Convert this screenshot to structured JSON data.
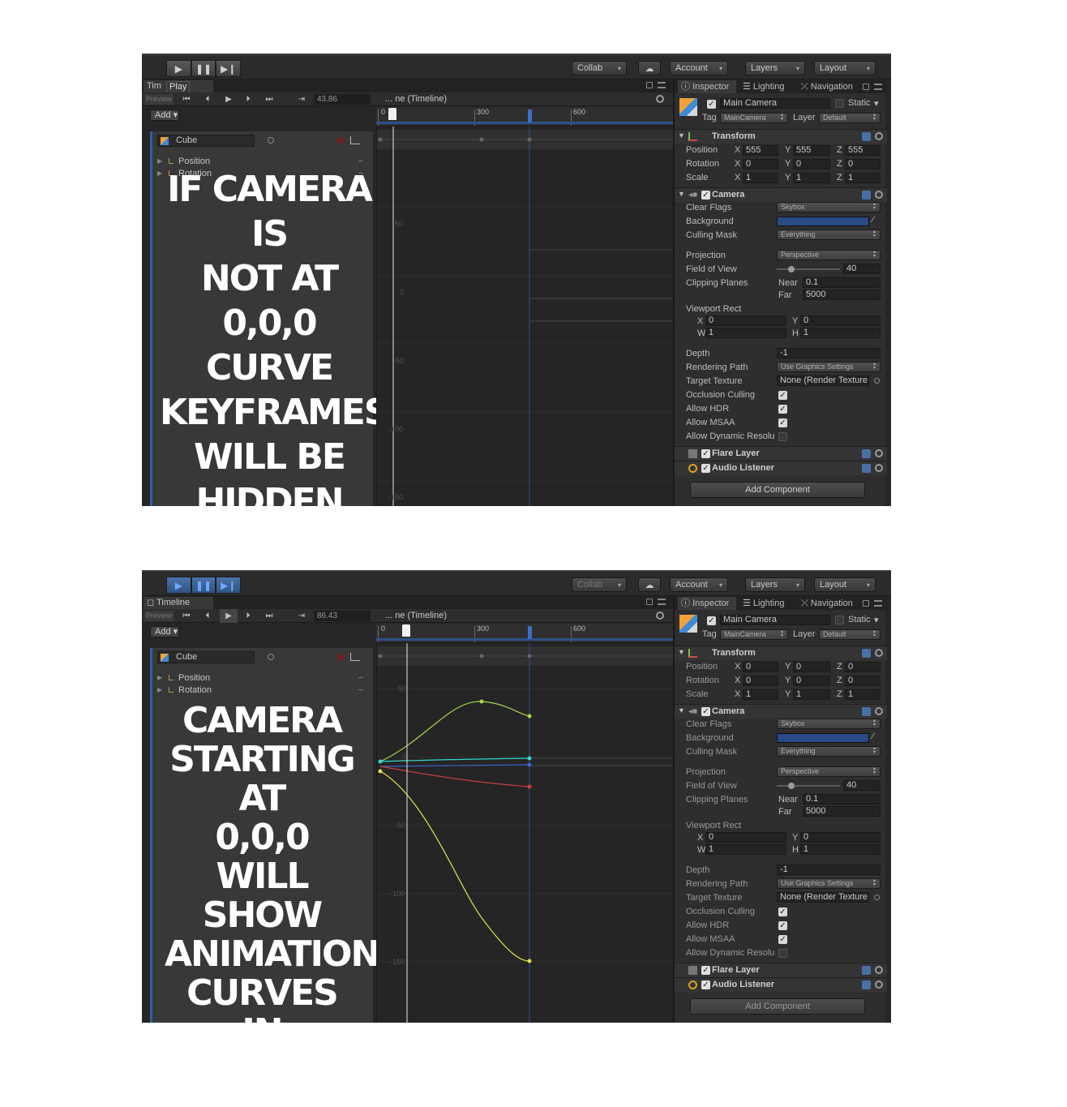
{
  "toolbar": {
    "collab": "Collab",
    "account": "Account",
    "layers": "Layers",
    "layout": "Layout"
  },
  "timeline": {
    "tab_label_1": "Tim",
    "tab_label_2": "Timeline",
    "tooltip": "Play",
    "preview": "Preview",
    "frame_1": "43.86",
    "frame_2": "86.43",
    "binding": "... ne (Timeline)",
    "add_button": "Add",
    "track_object": "Cube",
    "properties": [
      "Position",
      "Rotation"
    ],
    "ruler_labels": [
      "0",
      "300",
      "600"
    ],
    "value_labels": [
      "50",
      "0",
      "-50",
      "-100",
      "-150"
    ]
  },
  "captions": {
    "top": "IF CAMERA IS\nNOT AT 0,0,0\nCURVE\nKEYFRAMES\nWILL BE HIDDEN\nAFTER PRESSING\nPLAY",
    "bottom": "CAMERA\nSTARTING AT\n0,0,0 WILL\nSHOW\nANIMATION\nCURVES IN\nTIMELINE"
  },
  "inspector": {
    "tabs": [
      "Inspector",
      "Lighting",
      "Navigation"
    ],
    "object_name": "Main Camera",
    "static": "Static",
    "tag_label": "Tag",
    "tag_value": "MainCamera",
    "layer_label": "Layer",
    "layer_value": "Default",
    "transform": {
      "title": "Transform",
      "labels": [
        "Position",
        "Rotation",
        "Scale"
      ],
      "axes": [
        "X",
        "Y",
        "Z"
      ],
      "values_1": [
        [
          "555",
          "555",
          "555"
        ],
        [
          "0",
          "0",
          "0"
        ],
        [
          "1",
          "1",
          "1"
        ]
      ],
      "values_2": [
        [
          "0",
          "0",
          "0"
        ],
        [
          "0",
          "0",
          "0"
        ],
        [
          "1",
          "1",
          "1"
        ]
      ]
    },
    "camera": {
      "title": "Camera",
      "clear_flags": "Clear Flags",
      "clear_flags_value": "Skybox",
      "background": "Background",
      "background_color": "#2a4a86",
      "culling_mask": "Culling Mask",
      "culling_mask_value": "Everything",
      "projection": "Projection",
      "projection_value": "Perspective",
      "fov": "Field of View",
      "fov_value": "40",
      "clipping": "Clipping Planes",
      "near": "Near",
      "near_value": "0.1",
      "far": "Far",
      "far_value": "5000",
      "viewport": "Viewport Rect",
      "vp_x": "X",
      "vp_x_value": "0",
      "vp_y": "Y",
      "vp_y_value": "0",
      "vp_w": "W",
      "vp_w_value": "1",
      "vp_h": "H",
      "vp_h_value": "1",
      "depth": "Depth",
      "depth_value": "-1",
      "render_path": "Rendering Path",
      "render_path_value": "Use Graphics Settings",
      "target_texture": "Target Texture",
      "target_texture_value": "None (Render Texture",
      "occlusion": "Occlusion Culling",
      "hdr": "Allow HDR",
      "msaa": "Allow MSAA",
      "dynres": "Allow Dynamic Resolu"
    },
    "flare_layer": "Flare Layer",
    "audio_listener": "Audio Listener",
    "add_component": "Add Component"
  },
  "colors": {
    "accent_blue": "#2f5ea5",
    "playhead": "#f2f2f2",
    "curve_green": "#a7d84a",
    "curve_yellow": "#e3e34a",
    "curve_cyan": "#34d6d0",
    "curve_blue": "#3a66d6",
    "curve_red": "#c94040"
  }
}
